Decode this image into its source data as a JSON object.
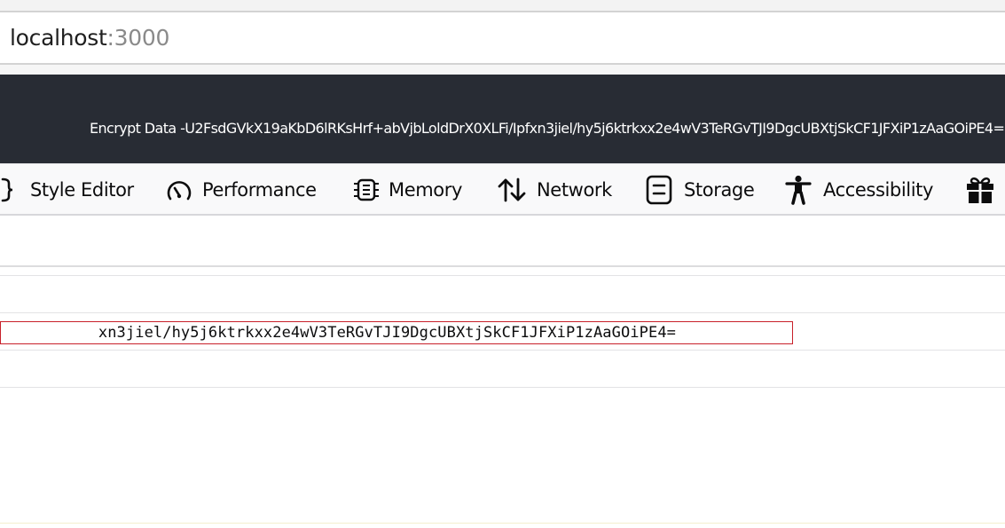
{
  "browser": {
    "url_host": "localhost",
    "url_port": ":3000"
  },
  "page": {
    "encrypt_line": "Encrypt Data -U2FsdGVkX19aKbD6lRKsHrf+abVjbLoldDrX0XLFi/Ipfxn3jiel/hy5j6ktrkxx2e4wV3TeRGvTJI9DgcUBXtjSkCF1JFXiP1zAaGOiPE4="
  },
  "devtools": {
    "tabs": [
      {
        "label": "Style Editor",
        "icon": "braces-icon"
      },
      {
        "label": "Performance",
        "icon": "gauge-icon"
      },
      {
        "label": "Memory",
        "icon": "memory-chip-icon"
      },
      {
        "label": "Network",
        "icon": "up-down-arrows-icon"
      },
      {
        "label": "Storage",
        "icon": "storage-icon"
      },
      {
        "label": "Accessibility",
        "icon": "accessibility-person-icon"
      },
      {
        "label": "",
        "icon": "gift-icon"
      }
    ],
    "highlighted_value": "xn3jiel/hy5j6ktrkxx2e4wV3TeRGvTJI9DgcUBXtjSkCF1JFXiP1zAaGOiPE4="
  },
  "colors": {
    "band": "#282c34",
    "highlight_border": "#c8202a",
    "port_text": "#8a8a8a"
  }
}
